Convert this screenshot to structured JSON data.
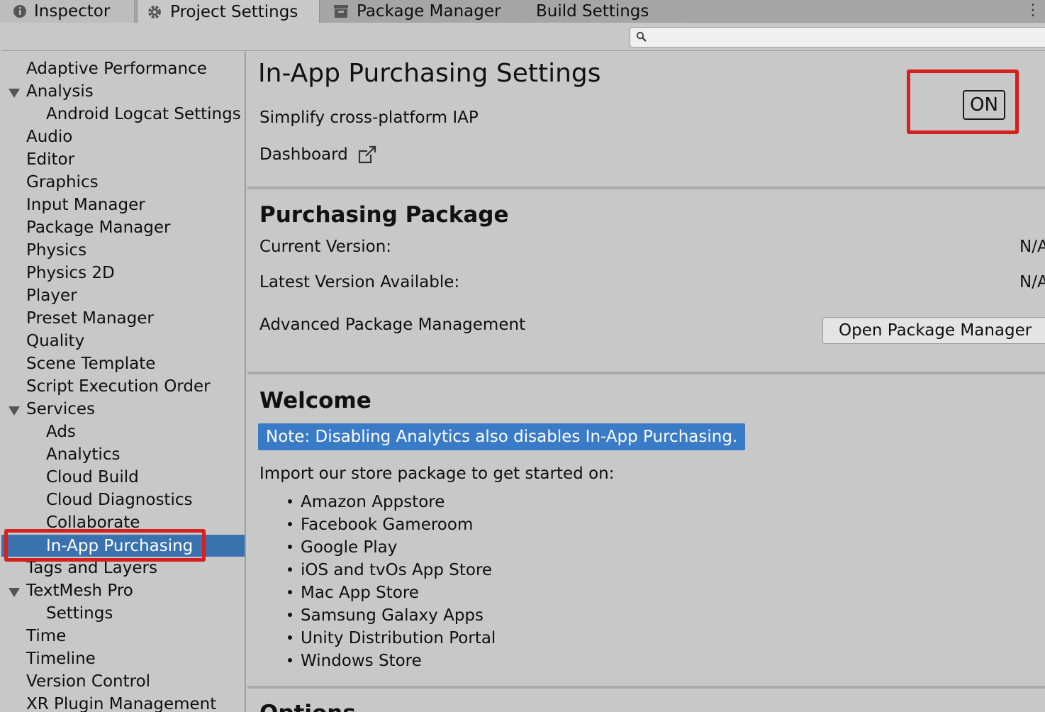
{
  "tabs": [
    {
      "label": "Inspector",
      "icon": "info-icon"
    },
    {
      "label": "Project Settings",
      "icon": "gear-icon"
    },
    {
      "label": "Package Manager",
      "icon": "package-icon"
    },
    {
      "label": "Build Settings",
      "icon": ""
    }
  ],
  "search": {
    "placeholder": ""
  },
  "sidebar": {
    "items": [
      {
        "label": "Adaptive Performance",
        "level": 0
      },
      {
        "label": "Analysis",
        "level": 0,
        "expanded": true
      },
      {
        "label": "Android Logcat Settings",
        "level": 1
      },
      {
        "label": "Audio",
        "level": 0
      },
      {
        "label": "Editor",
        "level": 0
      },
      {
        "label": "Graphics",
        "level": 0
      },
      {
        "label": "Input Manager",
        "level": 0
      },
      {
        "label": "Package Manager",
        "level": 0
      },
      {
        "label": "Physics",
        "level": 0
      },
      {
        "label": "Physics 2D",
        "level": 0
      },
      {
        "label": "Player",
        "level": 0
      },
      {
        "label": "Preset Manager",
        "level": 0
      },
      {
        "label": "Quality",
        "level": 0
      },
      {
        "label": "Scene Template",
        "level": 0
      },
      {
        "label": "Script Execution Order",
        "level": 0
      },
      {
        "label": "Services",
        "level": 0,
        "expanded": true
      },
      {
        "label": "Ads",
        "level": 1
      },
      {
        "label": "Analytics",
        "level": 1
      },
      {
        "label": "Cloud Build",
        "level": 1
      },
      {
        "label": "Cloud Diagnostics",
        "level": 1
      },
      {
        "label": "Collaborate",
        "level": 1
      },
      {
        "label": "In-App Purchasing",
        "level": 1,
        "selected": true
      },
      {
        "label": "Tags and Layers",
        "level": 0
      },
      {
        "label": "TextMesh Pro",
        "level": 0,
        "expanded": true
      },
      {
        "label": "Settings",
        "level": 1
      },
      {
        "label": "Time",
        "level": 0
      },
      {
        "label": "Timeline",
        "level": 0
      },
      {
        "label": "Version Control",
        "level": 0
      },
      {
        "label": "XR Plugin Management",
        "level": 0
      }
    ]
  },
  "main": {
    "title": "In-App Purchasing Settings",
    "subtitle": "Simplify cross-platform IAP",
    "dashboard_label": "Dashboard",
    "toggle_label": "ON",
    "purchasing": {
      "title": "Purchasing Package",
      "current_version_label": "Current Version:",
      "current_version_value": "N/A",
      "latest_version_label": "Latest Version Available:",
      "latest_version_value": "N/A",
      "advanced_label": "Advanced Package Management",
      "open_button": "Open Package Manager"
    },
    "welcome": {
      "title": "Welcome",
      "note": "Note: Disabling Analytics also disables In-App Purchasing.",
      "intro": "Import our store package to get started on:",
      "stores": [
        "Amazon Appstore",
        "Facebook Gameroom",
        "Google Play",
        "iOS and tvOs App Store",
        "Mac App Store",
        "Samsung Galaxy Apps",
        "Unity Distribution Portal",
        "Windows Store"
      ]
    },
    "next_section_title": "Options"
  },
  "colors": {
    "selection": "#3a72b0",
    "note_bg": "#3a7bc8",
    "highlight_border": "#d62020",
    "panel_bg": "#c8c8c8"
  }
}
